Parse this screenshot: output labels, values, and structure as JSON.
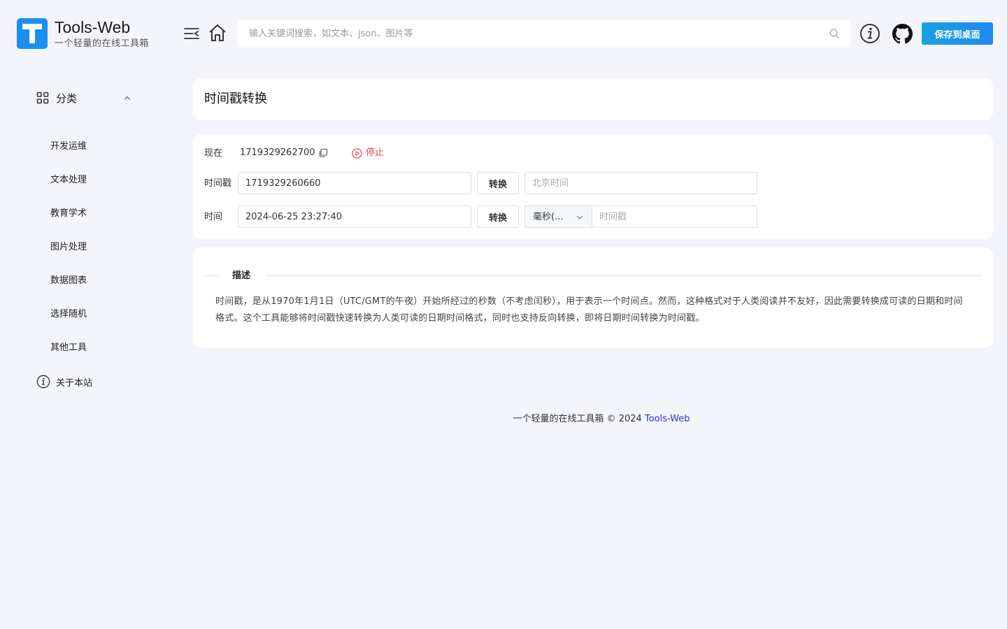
{
  "header": {
    "brand": "Tools-Web",
    "tagline": "一个轻量的在线工具箱",
    "search_placeholder": "输入关键词搜索，如文本、json、图片等",
    "save_label": "保存到桌面"
  },
  "sidebar": {
    "category_label": "分类",
    "items": [
      {
        "label": "开发运维"
      },
      {
        "label": "文本处理"
      },
      {
        "label": "教育学术"
      },
      {
        "label": "图片处理"
      },
      {
        "label": "数据图表"
      },
      {
        "label": "选择随机"
      },
      {
        "label": "其他工具"
      }
    ],
    "about_label": "关于本站"
  },
  "page": {
    "title": "时间戳转换"
  },
  "tool": {
    "now_label": "现在",
    "now_value": "1719329262700",
    "stop_label": "停止",
    "timestamp_label": "时间戳",
    "timestamp_value": "1719329260660",
    "convert_label": "转换",
    "beijing_placeholder": "北京时间",
    "time_label": "时间",
    "time_value": "2024-06-25 23:27:40",
    "unit_value": "毫秒(...",
    "timestamp_result_placeholder": "时间戳"
  },
  "description": {
    "title": "描述",
    "text": "时间戳，是从1970年1月1日（UTC/GMT的午夜）开始所经过的秒数（不考虑闰秒），用于表示一个时间点。然而，这种格式对于人类阅读并不友好，因此需要转换成可读的日期和时间格式。这个工具能够将时间戳快速转换为人类可读的日期时间格式，同时也支持反向转换，即将日期时间转换为时间戳。"
  },
  "footer": {
    "text": "一个轻量的在线工具箱 © 2024",
    "brand": "Tools-Web"
  },
  "colors": {
    "accent": "#1b8ff0",
    "stop": "#e8474b",
    "background": "#f4f5fa",
    "link": "#2b2fd6"
  }
}
